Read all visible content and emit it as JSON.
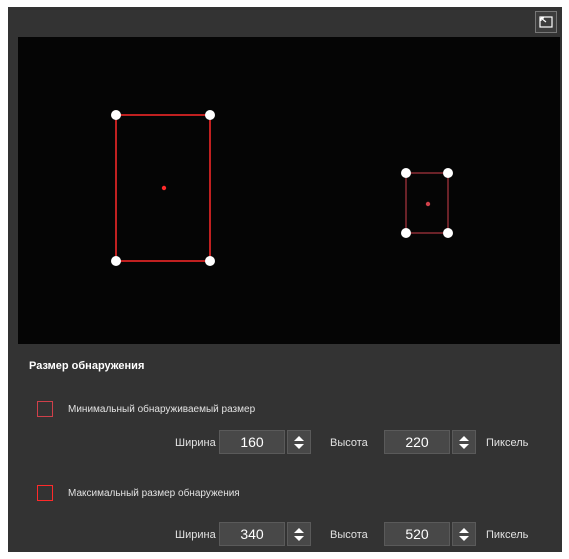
{
  "section_title": "Размер обнаружения",
  "min": {
    "label": "Минимальный обнаруживаемый размер",
    "width_label": "Ширина",
    "width": "160",
    "height_label": "Высота",
    "height": "220",
    "unit": "Пиксель",
    "color": "#d0404a"
  },
  "max": {
    "label": "Максимальный размер обнаружения",
    "width_label": "Ширина",
    "width": "340",
    "height_label": "Высота",
    "height": "520",
    "unit": "Пиксель",
    "color": "#ff2a2a"
  },
  "colors": {
    "panel": "#333333",
    "preview": "#050505",
    "handle": "#ffffff"
  },
  "icons": [
    "fullscreen-icon",
    "spin-up-icon",
    "spin-down-icon"
  ]
}
